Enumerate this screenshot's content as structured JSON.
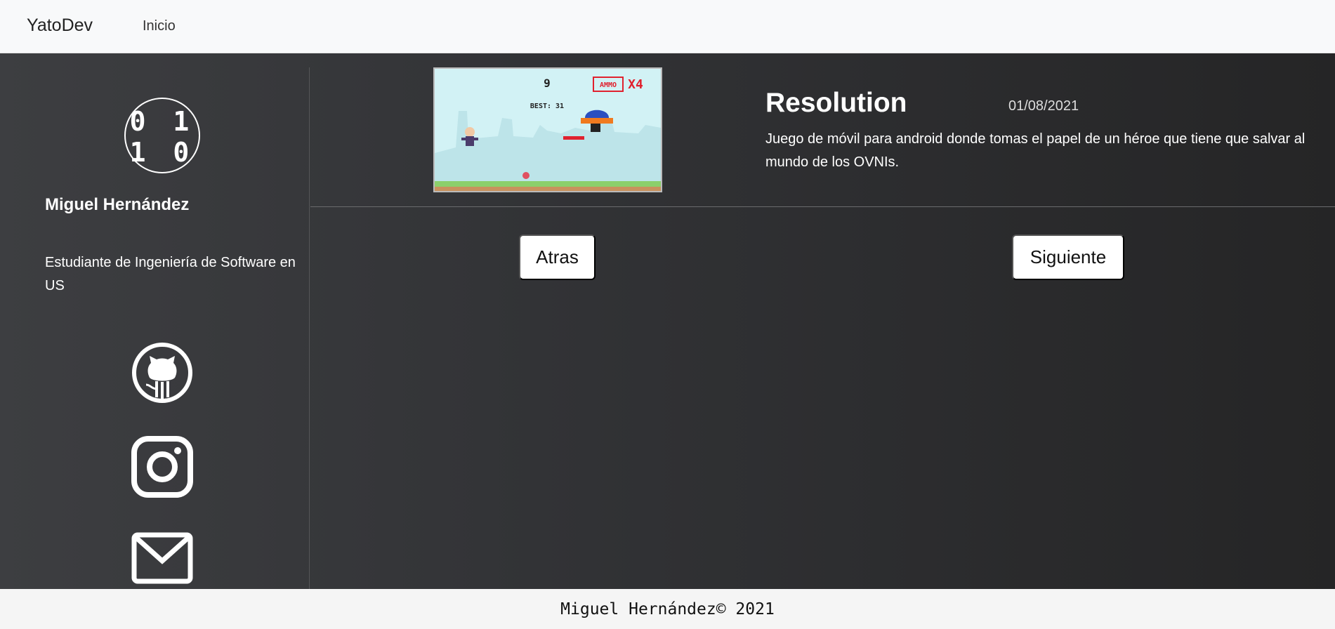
{
  "navbar": {
    "brand": "YatoDev",
    "links": [
      "Inicio"
    ]
  },
  "sidebar": {
    "logo": {
      "row1": "0 1",
      "row2": "1 0"
    },
    "name": "Miguel Hernández",
    "description": "Estudiante de Ingeniería de Software en US",
    "social": [
      "github-icon",
      "instagram-icon",
      "mail-icon"
    ]
  },
  "project": {
    "title": "Resolution",
    "date": "01/08/2021",
    "description": "Juego de móvil para android donde tomas el papel de un héroe que tiene que salvar al mundo de los OVNIs.",
    "screenshot": {
      "score": "9",
      "best": "BEST: 31",
      "ammo_label": "AMMO",
      "ammo_count": "X4"
    }
  },
  "pagination": {
    "back_label": "Atras",
    "next_label": "Siguiente"
  },
  "footer": {
    "text": "Miguel Hernández© 2021"
  },
  "colors": {
    "navbar_bg": "#f8f9fa",
    "main_bg": "#2f3033",
    "footer_bg": "#f5f5f5",
    "ammo_red": "#e0212e"
  }
}
